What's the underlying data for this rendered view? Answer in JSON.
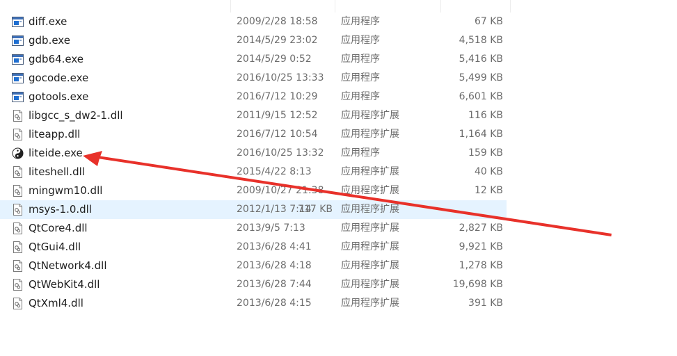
{
  "files": [
    {
      "name": "diff.exe",
      "date": "2009/2/28 18:58",
      "type": "应用程序",
      "size": "67 KB",
      "icon": "exe-icon"
    },
    {
      "name": "gdb.exe",
      "date": "2014/5/29 23:02",
      "type": "应用程序",
      "size": "4,518 KB",
      "icon": "exe-icon"
    },
    {
      "name": "gdb64.exe",
      "date": "2014/5/29 0:52",
      "type": "应用程序",
      "size": "5,416 KB",
      "icon": "exe-icon"
    },
    {
      "name": "gocode.exe",
      "date": "2016/10/25 13:33",
      "type": "应用程序",
      "size": "5,499 KB",
      "icon": "exe-icon"
    },
    {
      "name": "gotools.exe",
      "date": "2016/7/12 10:29",
      "type": "应用程序",
      "size": "6,601 KB",
      "icon": "exe-icon"
    },
    {
      "name": "libgcc_s_dw2-1.dll",
      "date": "2011/9/15 12:52",
      "type": "应用程序扩展",
      "size": "116 KB",
      "icon": "dll-icon"
    },
    {
      "name": "liteapp.dll",
      "date": "2016/7/12 10:54",
      "type": "应用程序扩展",
      "size": "1,164 KB",
      "icon": "dll-icon"
    },
    {
      "name": "liteide.exe",
      "date": "2016/10/25 13:32",
      "type": "应用程序",
      "size": "159 KB",
      "icon": "liteide-icon"
    },
    {
      "name": "liteshell.dll",
      "date": "2015/4/22 8:13",
      "type": "应用程序扩展",
      "size": "40 KB",
      "icon": "dll-icon"
    },
    {
      "name": "mingwm10.dll",
      "date": "2009/10/27 21:38",
      "type": "应用程序扩展",
      "size": "12 KB",
      "icon": "dll-icon"
    },
    {
      "name": "msys-1.0.dll",
      "date": "2012/1/13 7:14",
      "type": "应用程序扩展",
      "size": "717 KB",
      "icon": "dll-icon",
      "hovered": true
    },
    {
      "name": "QtCore4.dll",
      "date": "2013/9/5 7:13",
      "type": "应用程序扩展",
      "size": "2,827 KB",
      "icon": "dll-icon"
    },
    {
      "name": "QtGui4.dll",
      "date": "2013/6/28 4:41",
      "type": "应用程序扩展",
      "size": "9,921 KB",
      "icon": "dll-icon"
    },
    {
      "name": "QtNetwork4.dll",
      "date": "2013/6/28 4:18",
      "type": "应用程序扩展",
      "size": "1,278 KB",
      "icon": "dll-icon"
    },
    {
      "name": "QtWebKit4.dll",
      "date": "2013/6/28 7:44",
      "type": "应用程序扩展",
      "size": "19,698 KB",
      "icon": "dll-icon"
    },
    {
      "name": "QtXml4.dll",
      "date": "2013/6/28 4:15",
      "type": "应用程序扩展",
      "size": "391 KB",
      "icon": "dll-icon"
    }
  ],
  "colors": {
    "arrow": "#e8312a",
    "hover_row": "#e5f3ff",
    "exe_icon_blue": "#1f6fd1"
  },
  "annotation": {
    "type": "arrow",
    "points_to": "liteide.exe"
  }
}
